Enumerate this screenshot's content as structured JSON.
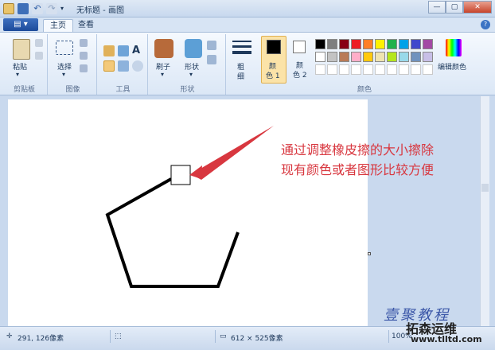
{
  "window": {
    "title": "无标题 - 画图",
    "minimize": "—",
    "maximize": "▢",
    "close": "✕"
  },
  "tabs": {
    "file": "▤ ▾",
    "home": "主页",
    "view": "查看",
    "help": "?"
  },
  "ribbon": {
    "clipboard": {
      "paste": "粘贴",
      "label": "剪贴板"
    },
    "image": {
      "select": "选择",
      "label": "图像"
    },
    "tools": {
      "label": "工具"
    },
    "shapes": {
      "brushes": "刷子",
      "shapes": "形状",
      "label": "形状"
    },
    "size": {
      "label1": "粗",
      "label2": "细"
    },
    "colors": {
      "color1": "颜\n色 1",
      "color1a": "颜",
      "color1b": "色 1",
      "color2a": "颜",
      "color2b": "色 2",
      "edit": "编辑颜色",
      "label": "颜色"
    },
    "palette_row1": [
      "#000000",
      "#7f7f7f",
      "#880015",
      "#ed1c24",
      "#ff7f27",
      "#fff200",
      "#22b14c",
      "#00a2e8",
      "#3f48cc",
      "#a349a4"
    ],
    "palette_row2": [
      "#ffffff",
      "#c3c3c3",
      "#b97a57",
      "#ffaec9",
      "#ffc90e",
      "#efe4b0",
      "#b5e61d",
      "#99d9ea",
      "#7092be",
      "#c8bfe7"
    ]
  },
  "annotation": {
    "line1": "通过调整橡皮擦的大小擦除",
    "line2": "现有颜色或者图形比较方便"
  },
  "status": {
    "cursor": "291, 126像素",
    "size": "612 × 525像素",
    "zoom": "100%"
  },
  "watermark": {
    "line1": "壹聚教程",
    "line2": "拓森运维",
    "line3": "www.tlltd.com"
  }
}
